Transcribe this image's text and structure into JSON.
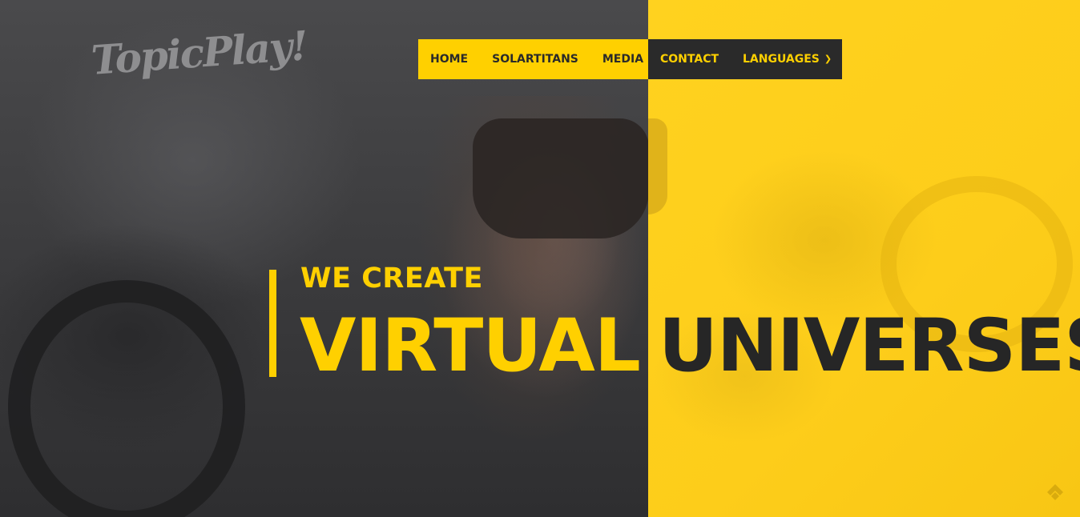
{
  "brand": {
    "logo_text": "TopicPlay!"
  },
  "nav": {
    "items": [
      {
        "label": "HOME"
      },
      {
        "label": "SOLARTITANS"
      },
      {
        "label": "MEDIA"
      },
      {
        "label": "CONTACT"
      },
      {
        "label": "LANGUAGES"
      }
    ],
    "dropdown_icon": "chevron-down-icon"
  },
  "hero": {
    "subtitle": "WE CREATE",
    "title_word_1": "VIRTUAL",
    "title_word_2": "UNIVERSES"
  },
  "colors": {
    "accent": "#ffd000",
    "dark": "#2a2a2a",
    "overlay_dark": "#3a3a3c"
  },
  "corner_icon": "feedly-icon"
}
